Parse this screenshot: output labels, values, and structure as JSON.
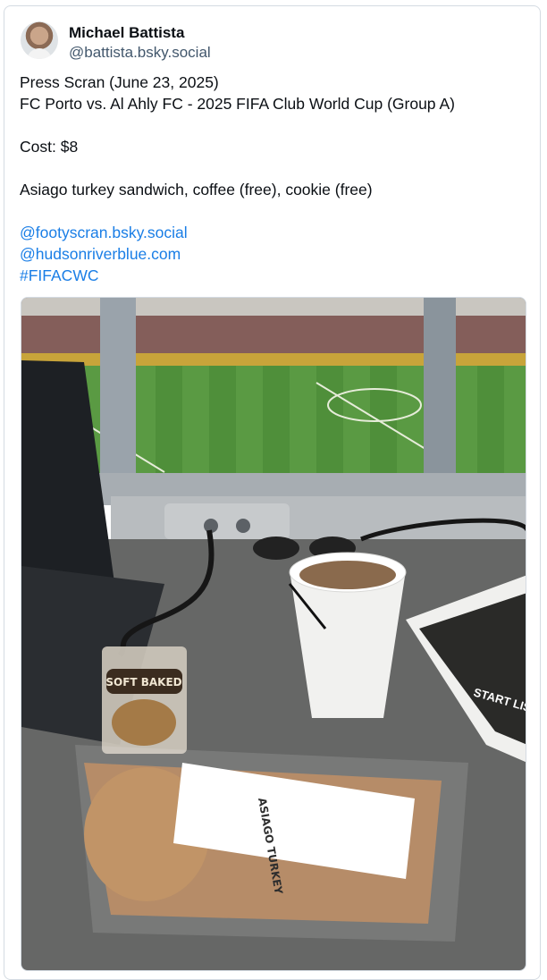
{
  "post": {
    "author_name": "Michael Battista",
    "author_handle": "@battista.bsky.social",
    "lines": [
      "Press Scran (June 23, 2025)",
      "FC Porto vs. Al Ahly FC - 2025 FIFA Club World Cup (Group A)",
      "Cost: $8",
      "Asiago turkey sandwich, coffee (free), cookie (free)"
    ],
    "links": [
      "@footyscran.bsky.social",
      "@hudsonriverblue.com",
      "#FIFACWC"
    ]
  },
  "photo": {
    "cookie_label": "SOFT BAKED",
    "sandwich_label": "ASIAGO TURKEY",
    "sheet_title": "START LIST"
  },
  "colors": {
    "link": "#1a7ee6",
    "handle": "#42576c",
    "border": "#d4dbe2"
  }
}
